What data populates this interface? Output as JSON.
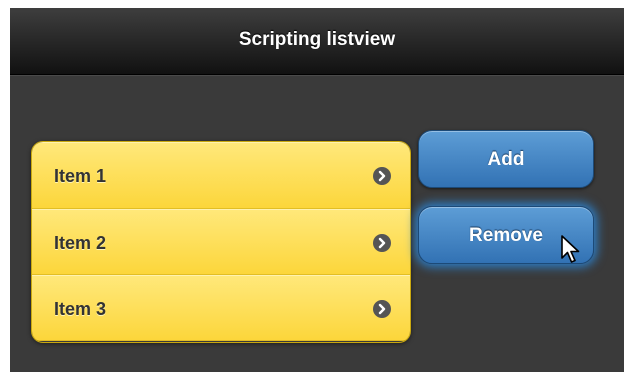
{
  "header": {
    "title": "Scripting listview"
  },
  "listview": {
    "items": [
      {
        "label": "Item 1",
        "icon": "chevron-right-icon"
      },
      {
        "label": "Item 2",
        "icon": "chevron-right-icon"
      },
      {
        "label": "Item 3",
        "icon": "chevron-right-icon"
      }
    ]
  },
  "buttons": {
    "add_label": "Add",
    "remove_label": "Remove"
  },
  "colors": {
    "header_dark": "#111111",
    "page_background": "#3a3a3a",
    "list_item_yellow": "#fcd63b",
    "button_blue": "#3272b4"
  }
}
